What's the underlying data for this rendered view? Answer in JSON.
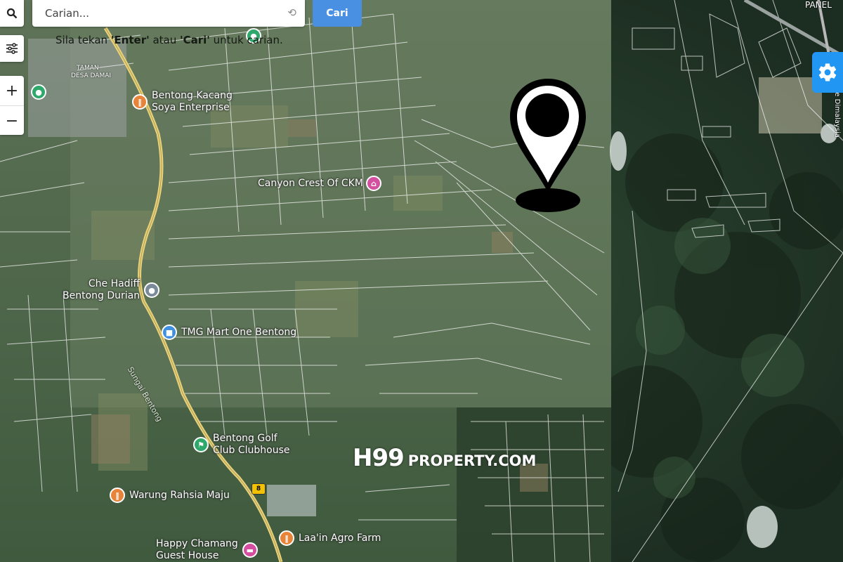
{
  "search": {
    "placeholder": "Carian...",
    "button_label": "Cari",
    "hint_prefix": "Sila tekan ",
    "hint_enter": "'Enter'",
    "hint_middle": " atau ",
    "hint_cari": "'Cari'",
    "hint_suffix": " untuk carian."
  },
  "map": {
    "corner_labels": {
      "taman_line1": "TAMAN",
      "taman_line2": "DESA DAMAI",
      "panel": "PANEL",
      "road_vertical": "Jln Ke Dimalaysia"
    },
    "road_sign": "8",
    "river_label": "Sungai Bentong",
    "pois": [
      {
        "id": "bentong-kacang",
        "label_line1": "Bentong Kacang",
        "label_line2": "Soya Enterprise",
        "color": "#e8833a",
        "icon": "restaurant-icon"
      },
      {
        "id": "canyon-crest",
        "label_line1": "Canyon Crest Of CKM",
        "label_line2": "",
        "color": "#d44fa0",
        "icon": "resort-icon"
      },
      {
        "id": "che-hadiff",
        "label_line1": "Che Hadiff",
        "label_line2": "Bentong Durian",
        "color": "#7a8a99",
        "icon": "place-icon"
      },
      {
        "id": "tmg-mart",
        "label_line1": "TMG Mart One Bentong",
        "label_line2": "",
        "color": "#3f8ee0",
        "icon": "shopping-icon"
      },
      {
        "id": "golf-club",
        "label_line1": "Bentong Golf",
        "label_line2": "Club Clubhouse",
        "color": "#2ea86b",
        "icon": "golf-icon"
      },
      {
        "id": "warung-rahsia",
        "label_line1": "Warung Rahsia Maju",
        "label_line2": "",
        "color": "#e8833a",
        "icon": "restaurant-icon"
      },
      {
        "id": "laain-agro",
        "label_line1": "Laa'in Agro Farm",
        "label_line2": "",
        "color": "#e8833a",
        "icon": "restaurant-icon"
      },
      {
        "id": "happy-chamang",
        "label_line1": "Happy Chamang",
        "label_line2": "Guest House",
        "color": "#d44fa0",
        "icon": "hotel-icon"
      }
    ]
  },
  "watermark": {
    "brand_mark": "H99",
    "brand_text": "PROPERTY.COM"
  },
  "colors": {
    "search_button": "#4a90e2",
    "settings_button": "#2196f3",
    "marker": "#000000"
  }
}
